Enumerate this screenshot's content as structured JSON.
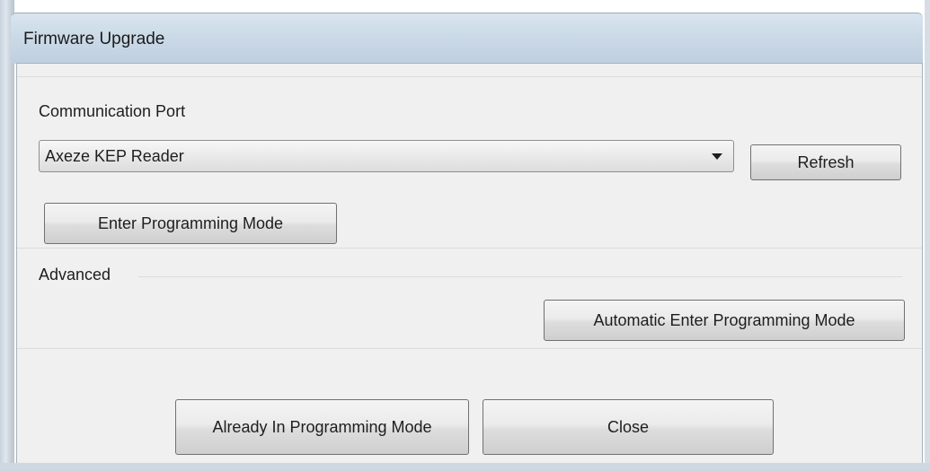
{
  "window": {
    "title": "Firmware Upgrade"
  },
  "port_section": {
    "label": "Communication Port",
    "selected_port": "Axeze KEP Reader",
    "refresh_label": "Refresh",
    "enter_programming_label": "Enter Programming Mode"
  },
  "advanced_section": {
    "label": "Advanced",
    "auto_enter_label": "Automatic Enter Programming Mode"
  },
  "footer": {
    "already_in_programming_label": "Already In Programming Mode",
    "close_label": "Close"
  },
  "colors": {
    "dialog_background": "#f0f0f0",
    "titlebar": "#c9d8e6"
  }
}
